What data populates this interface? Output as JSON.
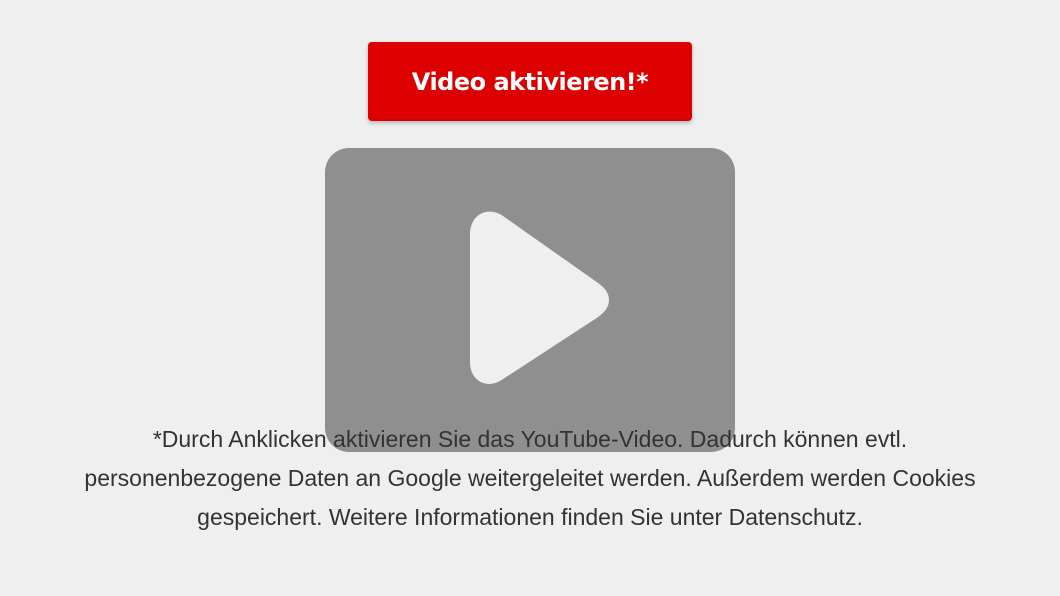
{
  "activate_button": {
    "label": "Video aktivieren!*"
  },
  "video_placeholder": {
    "icon": "play-icon",
    "box_color": "#8f8f8f"
  },
  "notice": {
    "lines": [
      "*Durch Anklicken aktivieren Sie das YouTube-Video. Dadurch können evtl.",
      "personenbezogene Daten an Google weitergeleitet werden. Außerdem werden Cookies",
      "gespeichert. Weitere Informationen finden Sie unter Datenschutz."
    ]
  },
  "colors": {
    "accent": "#dd0000",
    "background": "#efefef",
    "text": "#333333"
  }
}
